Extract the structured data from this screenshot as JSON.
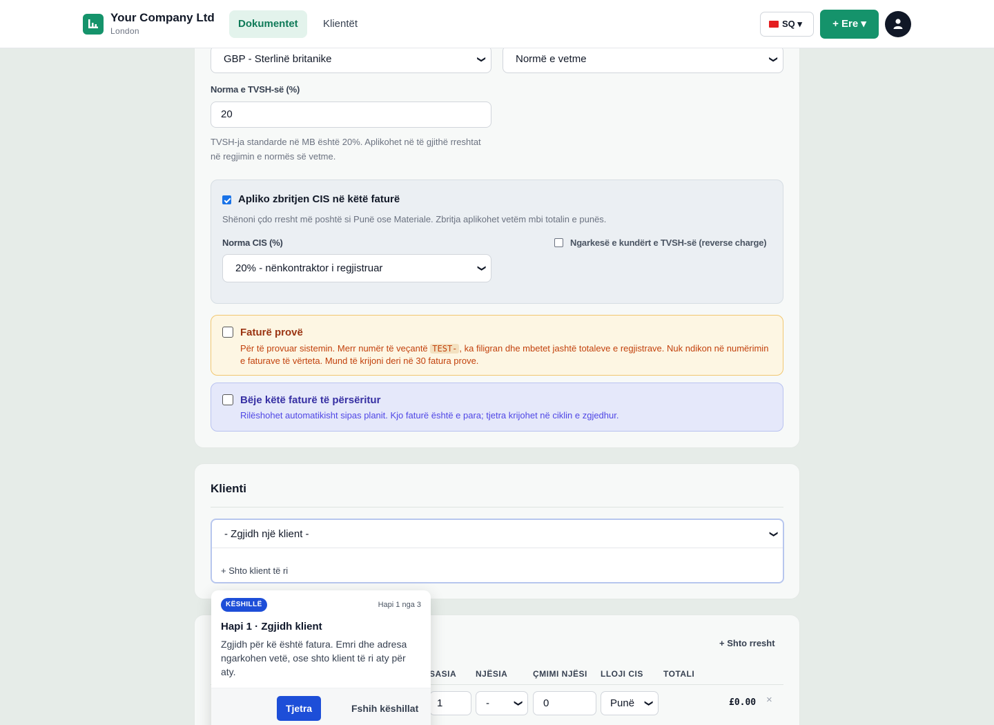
{
  "header": {
    "company_name": "Your Company Ltd",
    "company_city": "London",
    "nav": [
      {
        "label": "Dokumentet",
        "active": true
      },
      {
        "label": "Klientët",
        "active": false
      }
    ],
    "language": "SQ ▾",
    "new_button": "+ Ere ▾"
  },
  "invoice_settings": {
    "currency_value": "GBP - Sterlinë britanike",
    "vat_mode_value": "Normë e vetme",
    "vat_rate_label": "Norma e TVSH-së (%)",
    "vat_rate_value": "20",
    "vat_hint_line1": "TVSH-ja standarde në MB është 20%. Aplikohet në të gjithë rreshtat",
    "vat_hint_line2": "në regjimin e normës së vetme."
  },
  "cis": {
    "checked": true,
    "title": "Apliko zbritjen CIS në këtë faturë",
    "hint": "Shënoni çdo rresht më poshtë si Punë ose Materiale. Zbritja aplikohet vetëm mbi totalin e punës.",
    "rate_label": "Norma CIS (%)",
    "rate_value": "20% - nënkontraktor i regjistruar",
    "reverse_charge_label": "Ngarkesë e kundërt e TVSH-së (reverse charge)"
  },
  "test_invoice": {
    "title": "Faturë provë",
    "desc_before": "Për të provuar sistemin. Merr numër të veçantë ",
    "code": "TEST-",
    "desc_after": ", ka filigran dhe mbetet jashtë totaleve e regjistrave. Nuk ndikon në numërimin",
    "desc_line2": "e faturave të vërteta. Mund të krijoni deri në 30 fatura prove."
  },
  "recurring": {
    "title": "Bëje këtë faturë të përsëritur",
    "desc": "Rilëshohet automatikisht sipas planit. Kjo faturë është e para; tjetra krijohet në ciklin e zgjedhur."
  },
  "client_section": {
    "title": "Klienti",
    "select_placeholder": "- Zgjidh një klient -",
    "add_client": "+ Shto klient të ri"
  },
  "items": {
    "add_row": "+ Shto rresht",
    "columns": [
      "SASIA",
      "NJËSIA",
      "ÇMIMI NJËSI",
      "LLOJI CIS",
      "TOTALI"
    ],
    "row": {
      "quantity": "1",
      "unit": "-",
      "price": "0",
      "cis_type": "Punë",
      "total": "£0.00",
      "remove": "×"
    }
  },
  "tooltip": {
    "badge": "KËSHILLË",
    "step": "Hapi 1 nga 3",
    "title": "Hapi 1 · Zgjidh klient",
    "body": "Zgjidh për kë është fatura. Emri dhe adresa ngarkohen vetë, ose shto klient të ri aty për aty.",
    "next": "Tjetra",
    "hide": "Fshih këshillat"
  },
  "colors": {
    "brand": "#15936b",
    "tip_accent": "#1d4ed8",
    "test_title": "#9a3412",
    "test_text": "#c2410c",
    "recurring_title": "#3730a3",
    "recurring_text": "#4f46e5"
  },
  "icons": {
    "logo": "bar-chart-icon",
    "avatar": "user-icon",
    "select_arrow": "chevron-down-icon"
  }
}
